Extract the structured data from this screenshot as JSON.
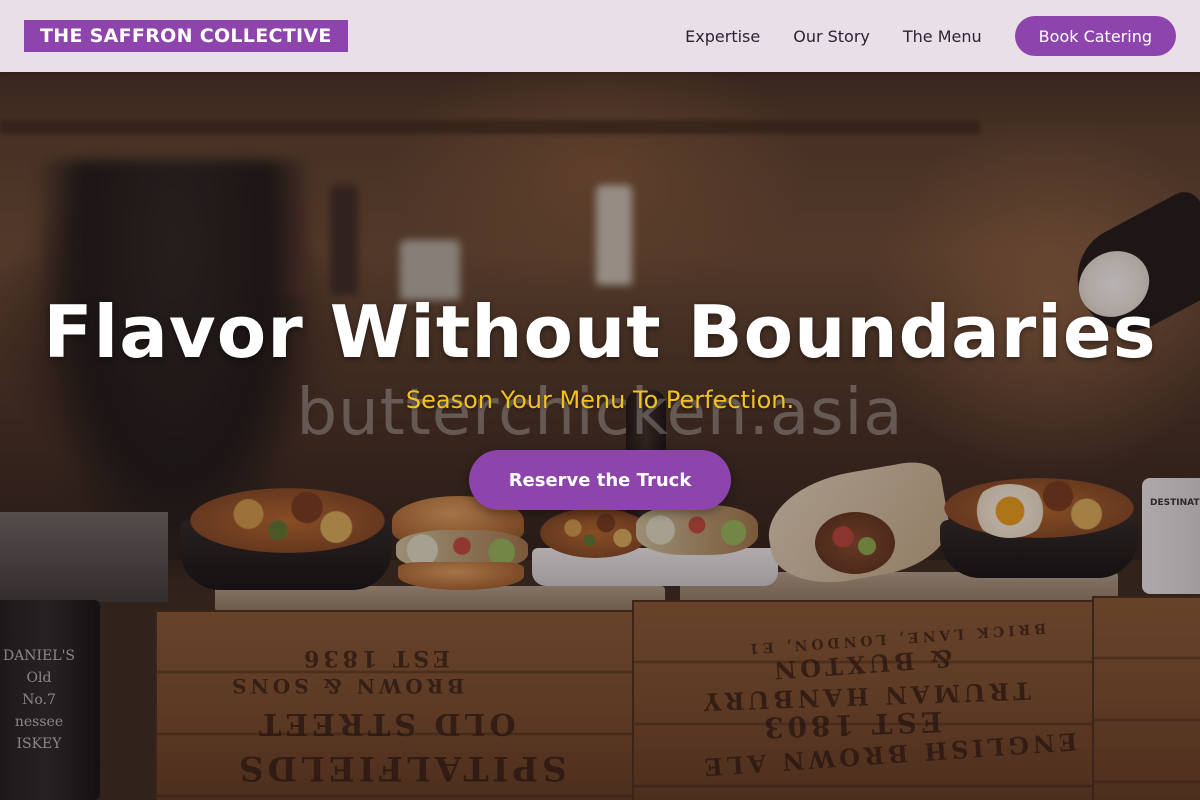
{
  "brand": {
    "name": "THE SAFFRON COLLECTIVE",
    "accent_color": "#8e44ad",
    "highlight_color": "#f4c21d"
  },
  "nav": {
    "links": [
      {
        "label": "Expertise"
      },
      {
        "label": "Our Story"
      },
      {
        "label": "The Menu"
      }
    ],
    "cta_label": "Book Catering"
  },
  "hero": {
    "title": "Flavor Without Boundaries",
    "subtitle": "Season Your Menu To Perfection.",
    "cta_label": "Reserve the Truck"
  },
  "watermark": {
    "text": "butterchicken.asia"
  },
  "background_photo": {
    "crate_left_lines": [
      "EST 1836",
      "BROWN & SONS",
      "OLD STREET",
      "SPITALFIELDS"
    ],
    "crate_right_lines": [
      "BRICK LANE, LONDON, E1",
      "& BUXTON",
      "TRUMAN HANBURY",
      "EST 1803",
      "ENGLISH BROWN ALE"
    ],
    "tin_lines": [
      "DANIEL'S",
      "Old",
      "No.7",
      "nessee",
      "ISKEY"
    ],
    "mug_text": "DESTINAT"
  }
}
